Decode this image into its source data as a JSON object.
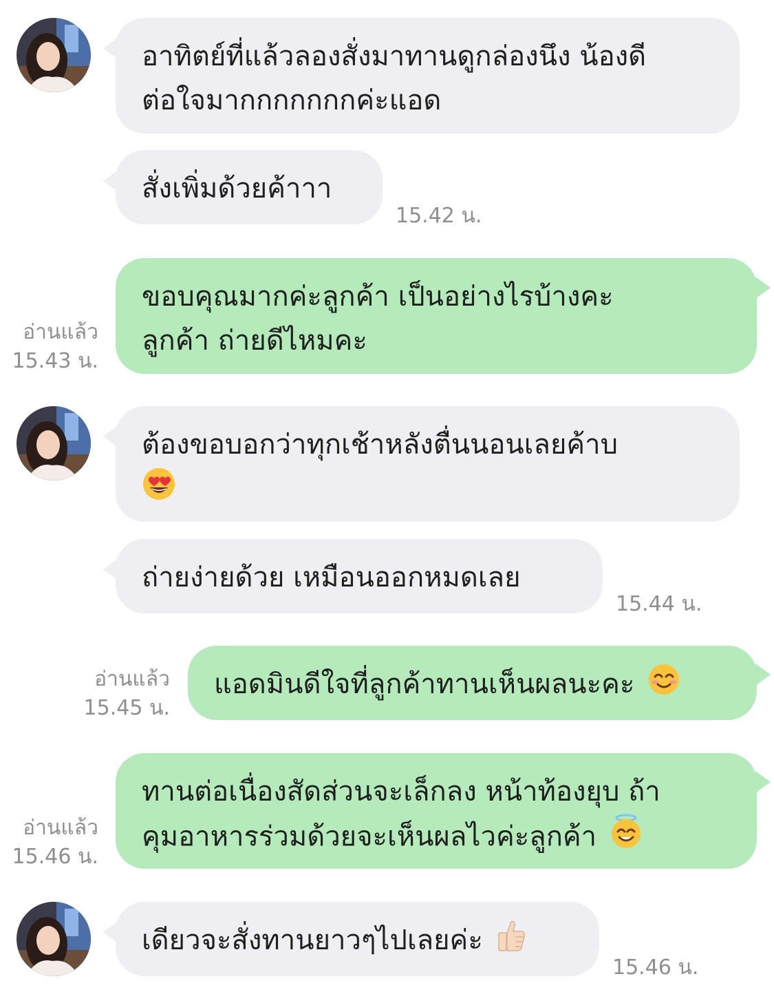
{
  "messages": [
    {
      "sender": "customer",
      "lines": [
        "อาทิตย์ที่แล้วลองสั่งมาทานดูกล่องนึง น้องดี",
        "ต่อใจมากกกกกกกค่ะแอด"
      ]
    },
    {
      "sender": "customer",
      "lines": [
        "สั่งเพิ่มด้วยค้าาา"
      ],
      "time": "15.42 น."
    },
    {
      "sender": "admin",
      "lines": [
        "ขอบคุณมากค่ะลูกค้า เป็นอย่างไรบ้างคะ",
        "ลูกค้า ถ่ายดีไหมคะ"
      ],
      "read": "อ่านแล้ว",
      "time": "15.43 น."
    },
    {
      "sender": "customer",
      "lines": [
        "ต้องขอบอกว่าทุกเช้าหลังตื่นนอนเลยค้าบ"
      ],
      "emoji": "heart-eyes-emoji"
    },
    {
      "sender": "customer",
      "lines": [
        "ถ่ายง่ายด้วย เหมือนออกหมดเลย"
      ],
      "time": "15.44 น."
    },
    {
      "sender": "admin",
      "lines": [
        "แอดมินดีใจที่ลูกค้าทานเห็นผลนะคะ"
      ],
      "emoji": "smiling-blush-emoji",
      "read": "อ่านแล้ว",
      "time": "15.45 น."
    },
    {
      "sender": "admin",
      "lines": [
        "ทานต่อเนื่องสัดส่วนจะเล็กลง หน้าท้องยุบ ถ้า",
        "คุมอาหารร่วมด้วยจะเห็นผลไวค่ะลูกค้า"
      ],
      "emoji": "halo-emoji",
      "read": "อ่านแล้ว",
      "time": "15.46 น."
    },
    {
      "sender": "customer",
      "lines": [
        "เดียวจะสั่งทานยาวๆไปเลยค่ะ"
      ],
      "emoji": "thumbs-up-emoji",
      "time": "15.46 น."
    }
  ],
  "colors": {
    "incoming_bubble": "#efeff1",
    "outgoing_bubble": "#b5ebbb",
    "meta_text": "#8e8e93"
  }
}
